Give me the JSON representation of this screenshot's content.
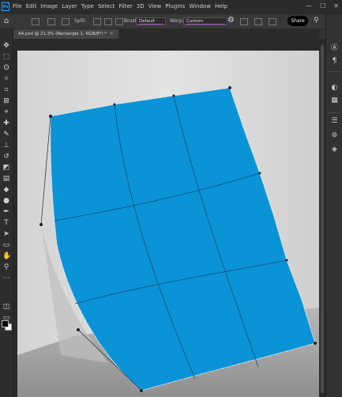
{
  "app": {
    "logo_text": "Ps"
  },
  "menu": [
    "File",
    "Edit",
    "Image",
    "Layer",
    "Type",
    "Select",
    "Filter",
    "3D",
    "View",
    "Plugins",
    "Window",
    "Help"
  ],
  "window_controls": {
    "minimize": "—",
    "maximize": "☐",
    "close": "✕"
  },
  "options": {
    "split_label": "Split:",
    "brush_label": "Brush",
    "brush_value": "Default",
    "warp_label": "Warp:",
    "warp_value": "Custom",
    "share_label": "Share",
    "accent_color": "#a14dd8"
  },
  "document": {
    "tab_label": "A4.psd @ 21.3% (Rectangle 1, RGB/8*) *",
    "close_glyph": "×"
  },
  "canvas": {
    "shape_color": "#0a93d6",
    "wall_color": "#e1e1e1",
    "floor_color": "#a3a3a3"
  },
  "tools": [
    {
      "name": "move-tool-icon",
      "glyph": "✥"
    },
    {
      "name": "marquee-tool-icon",
      "glyph": "⬚"
    },
    {
      "name": "lasso-tool-icon",
      "glyph": "ʘ"
    },
    {
      "name": "magic-wand-tool-icon",
      "glyph": "✧"
    },
    {
      "name": "crop-tool-icon",
      "glyph": "⌗"
    },
    {
      "name": "frame-tool-icon",
      "glyph": "⊠"
    },
    {
      "name": "eyedropper-tool-icon",
      "glyph": "⌖"
    },
    {
      "name": "healing-brush-tool-icon",
      "glyph": "✚"
    },
    {
      "name": "brush-tool-icon",
      "glyph": "✎"
    },
    {
      "name": "stamp-tool-icon",
      "glyph": "⊥"
    },
    {
      "name": "history-brush-tool-icon",
      "glyph": "↺"
    },
    {
      "name": "eraser-tool-icon",
      "glyph": "◩"
    },
    {
      "name": "gradient-tool-icon",
      "glyph": "▤"
    },
    {
      "name": "blur-tool-icon",
      "glyph": "◆"
    },
    {
      "name": "dodge-tool-icon",
      "glyph": "●"
    },
    {
      "name": "pen-tool-icon",
      "glyph": "✒"
    },
    {
      "name": "type-tool-icon",
      "glyph": "T"
    },
    {
      "name": "path-select-tool-icon",
      "glyph": "➤"
    },
    {
      "name": "rectangle-tool-icon",
      "glyph": "▭"
    },
    {
      "name": "hand-tool-icon",
      "glyph": "✋"
    },
    {
      "name": "zoom-tool-icon",
      "glyph": "⚲"
    },
    {
      "name": "more-tools-icon",
      "glyph": "⋯"
    }
  ],
  "panels": [
    {
      "name": "libraries-panel-icon",
      "glyph": "Ⓐ"
    },
    {
      "name": "paragraph-panel-icon",
      "glyph": "¶"
    },
    {
      "name": "color-panel-icon",
      "glyph": "◐"
    },
    {
      "name": "swatches-panel-icon",
      "glyph": "▦"
    },
    {
      "name": "properties-panel-icon",
      "glyph": "☰"
    },
    {
      "name": "channels-panel-icon",
      "glyph": "⊚"
    },
    {
      "name": "layers-panel-icon",
      "glyph": "◈"
    }
  ]
}
